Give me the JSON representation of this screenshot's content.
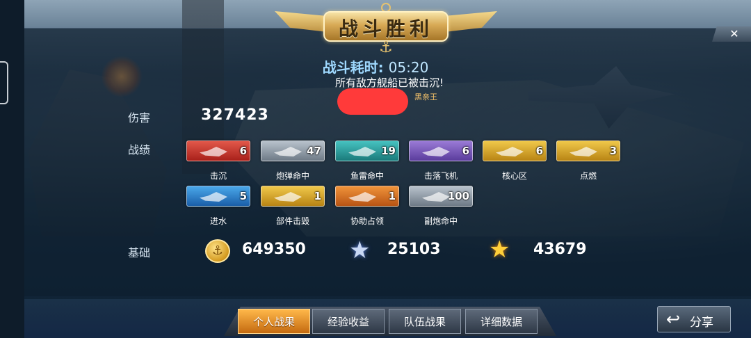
{
  "header": {
    "title": "战斗胜利",
    "time_label": "战斗耗时:",
    "time_value": "05:20",
    "subtitle": "所有敌方舰船已被击沉!",
    "player_name": "黑亲王",
    "close_label": "✕"
  },
  "damage": {
    "label": "伤害",
    "value": "327423"
  },
  "achievements": {
    "label": "战绩",
    "items": [
      {
        "label": "击沉",
        "count": "6",
        "color": "red"
      },
      {
        "label": "炮弹命中",
        "count": "47",
        "color": "silver"
      },
      {
        "label": "鱼雷命中",
        "count": "19",
        "color": "teal"
      },
      {
        "label": "击落飞机",
        "count": "6",
        "color": "purple"
      },
      {
        "label": "核心区",
        "count": "6",
        "color": "gold"
      },
      {
        "label": "点燃",
        "count": "3",
        "color": "gold"
      },
      {
        "label": "进水",
        "count": "5",
        "color": "blue"
      },
      {
        "label": "部件击毁",
        "count": "1",
        "color": "gold"
      },
      {
        "label": "协助占领",
        "count": "1",
        "color": "orange"
      },
      {
        "label": "副炮命中",
        "count": "100",
        "color": "silver"
      }
    ]
  },
  "basics": {
    "label": "基础",
    "coins": "649350",
    "silver_star": "25103",
    "gold_star": "43679"
  },
  "tabs": [
    {
      "label": "个人战果",
      "active": true
    },
    {
      "label": "经验收益",
      "active": false
    },
    {
      "label": "队伍战果",
      "active": false
    },
    {
      "label": "详细数据",
      "active": false
    }
  ],
  "share": {
    "label": "分享"
  },
  "icons": {
    "anchor": "anchor-icon",
    "coin": "coin-icon",
    "silver_star": "silver-star-icon",
    "gold_star": "gold-star-icon",
    "share": "share-arrow-icon",
    "close": "close-icon"
  }
}
